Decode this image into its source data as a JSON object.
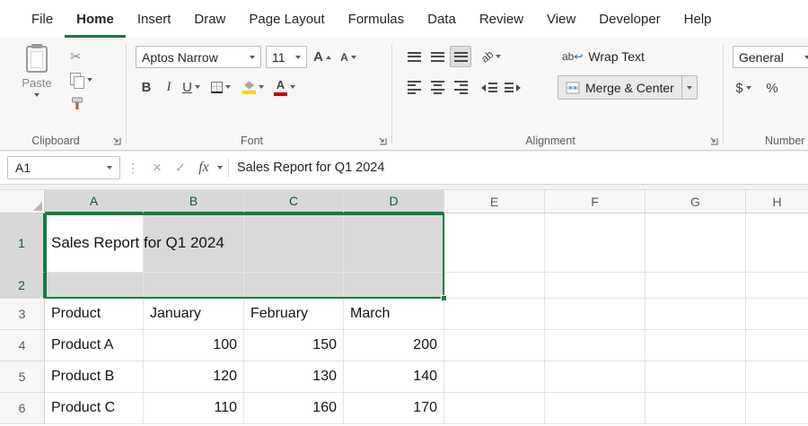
{
  "menu": {
    "tabs": [
      "File",
      "Home",
      "Insert",
      "Draw",
      "Page Layout",
      "Formulas",
      "Data",
      "Review",
      "View",
      "Developer",
      "Help"
    ],
    "active_tab": "Home"
  },
  "ribbon": {
    "clipboard": {
      "label": "Clipboard",
      "paste_label": "Paste"
    },
    "font": {
      "label": "Font",
      "font_name": "Aptos Narrow",
      "font_size": "11",
      "bold": "B",
      "italic": "I",
      "underline": "U"
    },
    "alignment": {
      "label": "Alignment",
      "wrap_text_label": "Wrap Text",
      "merge_center_label": "Merge & Center",
      "wrap_icon_text": "ab",
      "orientation_icon_text": "ab"
    },
    "number": {
      "label": "Number",
      "format": "General",
      "currency": "$",
      "percent": "%"
    }
  },
  "formula_bar": {
    "name_box": "A1",
    "cancel_glyph": "×",
    "enter_glyph": "✓",
    "fx_label": "fx",
    "drag_dots": "⋮",
    "formula": "Sales Report for Q1 2024"
  },
  "sheet": {
    "columns": [
      "A",
      "B",
      "C",
      "D",
      "E",
      "F",
      "G",
      "H"
    ],
    "rows": [
      {
        "num": "1",
        "A": "Sales Report for Q1 2024"
      },
      {
        "num": "2"
      },
      {
        "num": "3",
        "A": "Product",
        "B": "January",
        "C": "February",
        "D": "March"
      },
      {
        "num": "4",
        "A": "Product A",
        "B": "100",
        "C": "150",
        "D": "200"
      },
      {
        "num": "5",
        "A": "Product B",
        "B": "120",
        "C": "130",
        "D": "140"
      },
      {
        "num": "6",
        "A": "Product C",
        "B": "110",
        "C": "160",
        "D": "170"
      }
    ]
  },
  "colors": {
    "accent_green": "#107C41",
    "tab_underline_green": "#217346",
    "selection_fill": "#d9d9d9",
    "fill_color_swatch": "#ffd400",
    "font_color_swatch": "#c00000"
  }
}
